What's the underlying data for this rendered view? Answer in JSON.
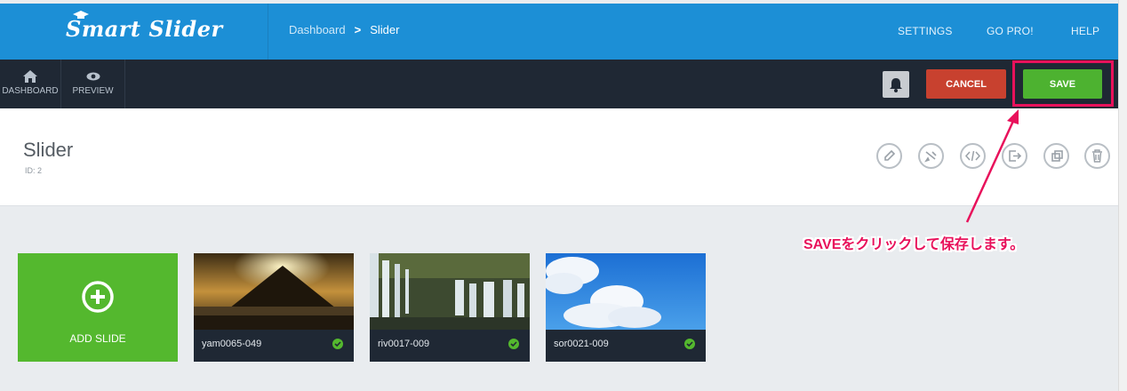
{
  "app": {
    "logo_text": "Smart Slider"
  },
  "breadcrumb": {
    "root": "Dashboard",
    "separator": ">",
    "current": "Slider"
  },
  "topnav": {
    "settings": "SETTINGS",
    "gopro": "GO PRO!",
    "help": "HELP"
  },
  "toolbar": {
    "dashboard_label": "DASHBOARD",
    "preview_label": "PREVIEW",
    "cancel_label": "CANCEL",
    "save_label": "SAVE"
  },
  "slider": {
    "title": "Slider",
    "id_text": "ID: 2"
  },
  "add_slide_label": "ADD SLIDE",
  "slides": [
    {
      "name": "yam0065-049"
    },
    {
      "name": "riv0017-009"
    },
    {
      "name": "sor0021-009"
    }
  ],
  "annotation": {
    "text": "SAVEをクリックして保存します。"
  },
  "icons": {
    "home": "home-icon",
    "preview": "eye-icon",
    "bell": "bell-icon",
    "edit": "pencil-icon",
    "style": "brush-icon",
    "code": "code-icon",
    "export": "export-icon",
    "duplicate": "duplicate-icon",
    "delete": "trash-icon",
    "add": "plus-circle-icon",
    "published": "check-circle-icon"
  },
  "colors": {
    "topbar": "#1c8fd6",
    "toolbar": "#1f2834",
    "cancel": "#c8412f",
    "save": "#4db230",
    "annotation": "#e8115b",
    "add_slide": "#54b82e"
  }
}
